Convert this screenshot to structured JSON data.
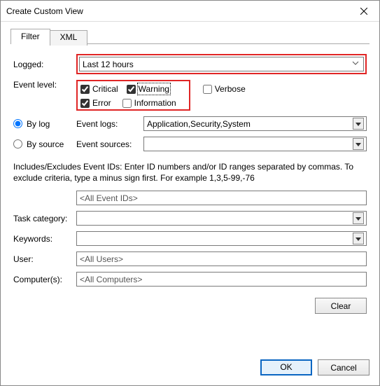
{
  "title": "Create Custom View",
  "tabs": {
    "filter": "Filter",
    "xml": "XML"
  },
  "labels": {
    "logged": "Logged:",
    "event_level": "Event level:",
    "by_log": "By log",
    "by_source": "By source",
    "event_logs": "Event logs:",
    "event_sources": "Event sources:",
    "task_category": "Task category:",
    "keywords": "Keywords:",
    "user": "User:",
    "computers": "Computer(s):"
  },
  "logged_value": "Last 12 hours",
  "levels": {
    "critical": "Critical",
    "warning": "Warning",
    "verbose": "Verbose",
    "error": "Error",
    "information": "Information"
  },
  "levels_checked": {
    "critical": true,
    "warning": true,
    "verbose": false,
    "error": true,
    "information": false
  },
  "by_log_selected": true,
  "event_logs_value": "Application,Security,System",
  "event_sources_value": "",
  "help_text": "Includes/Excludes Event IDs: Enter ID numbers and/or ID ranges separated by commas. To exclude criteria, type a minus sign first. For example 1,3,5-99,-76",
  "event_ids_value": "<All Event IDs>",
  "task_category_value": "",
  "keywords_value": "",
  "user_value": "<All Users>",
  "computers_value": "<All Computers>",
  "buttons": {
    "clear": "Clear",
    "ok": "OK",
    "cancel": "Cancel"
  }
}
